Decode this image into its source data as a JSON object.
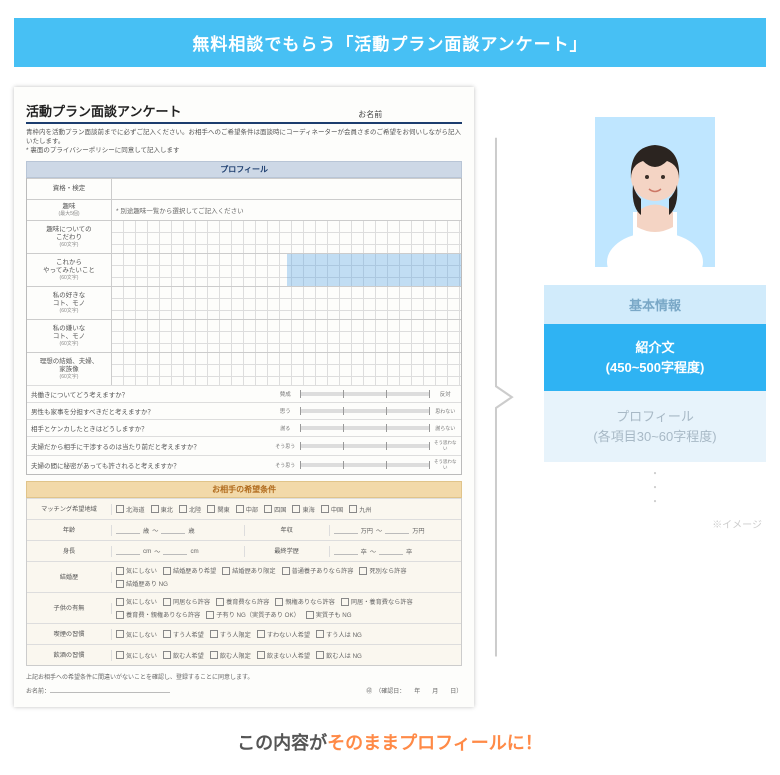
{
  "banner": "無料相談でもらう「活動プラン面談アンケート」",
  "sheet": {
    "title": "活動プラン面談アンケート",
    "name_label": "お名前",
    "note_line1": "青枠内を活動プラン面談前までに必ずご記入ください。お相手へのご希望条件は面談時にコーディネーターが会員さまのご希望をお伺いしながら記入いたします。",
    "note_line2": "* 裏面のプライバシーポリシーに同意して記入します",
    "profile_section": "プロフィール",
    "rows": {
      "qualification": "資格・検定",
      "hobby": "趣味",
      "hobby_sub": "(最大5個)",
      "hobby_note": "* 別途趣味一覧から選択してご記入ください",
      "hobby_detail": "趣味についての\nこだわり",
      "hobby_detail_sub": "(60文字)",
      "future": "これから\nやってみたいこと",
      "future_sub": "(60文字)",
      "like": "私の好きな\nコト、モノ",
      "like_sub": "(60文字)",
      "dislike": "私の嫌いな\nコト、モノ",
      "dislike_sub": "(60文字)",
      "ideal": "理想の結婚、夫婦、\n家族像",
      "ideal_sub": "(60文字)"
    },
    "sliders": {
      "q1": "共働きについてどう考えますか？",
      "q2": "男性も家事を分担すべきだと考えますか？",
      "q3": "相手とケンカしたときはどうしますか？",
      "q4": "夫婦だから相手に干渉するのは当たり前だと考えますか？",
      "q5": "夫婦の間に秘密があっても許されると考えますか？",
      "left_a": "賛成",
      "right_a": "反対",
      "left_b": "思う",
      "right_b": "思わない",
      "left_c": "そう思う",
      "right_c": "そう思わない"
    },
    "partner_section": "お相手の希望条件",
    "partner": {
      "region_label": "マッチング希望地域",
      "regions": [
        "北海道",
        "東北",
        "北陸",
        "関東",
        "中部",
        "四国",
        "東海",
        "中国",
        "九州"
      ],
      "age_label": "年齢",
      "age_unit": "歳",
      "tilde": "〜",
      "income_label": "年収",
      "income_unit": "万円",
      "height_label": "身長",
      "height_unit": "cm",
      "edu_label": "最終学歴",
      "edu_unit": "卒",
      "marriage_label": "結婚歴",
      "marriage_opts": [
        "気にしない",
        "結婚歴あり希望",
        "結婚歴あり限定",
        "普通養子ありなら許容",
        "死別なら許容",
        "結婚歴あり NG"
      ],
      "child_label": "子供の有無",
      "child_opts": [
        "気にしない",
        "同居なら許容",
        "養育費なら許容",
        "親権ありなら許容",
        "同居・養育費なら許容",
        "養育費・親権ありなら許容",
        "子有り NG（実質子あり OK）",
        "実質子も NG"
      ],
      "smoke_label": "喫煙の習慣",
      "smoke_opts": [
        "気にしない",
        "すう人希望",
        "すう人限定",
        "すわない人希望",
        "すう人は NG"
      ],
      "drink_label": "飲酒の習慣",
      "drink_opts": [
        "気にしない",
        "飲む人希望",
        "飲む人限定",
        "飲まない人希望",
        "飲む人は NG"
      ]
    },
    "footer_note": "上記お相手への希望条件に間違いがないことを確認し、登録することに同意します。",
    "footer_name": "お名前：",
    "footer_stamp": "㊞",
    "footer_confirm": "（確認日：　　年　　月　　日）"
  },
  "right": {
    "basic": "基本情報",
    "intro_line1": "紹介文",
    "intro_line2": "(450~500字程度)",
    "profile_line1": "プロフィール",
    "profile_line2": "(各項目30~60字程度)",
    "img_note": "※イメージ"
  },
  "footer": {
    "part1": "この内容が",
    "accent": "そのままプロフィールに！"
  }
}
